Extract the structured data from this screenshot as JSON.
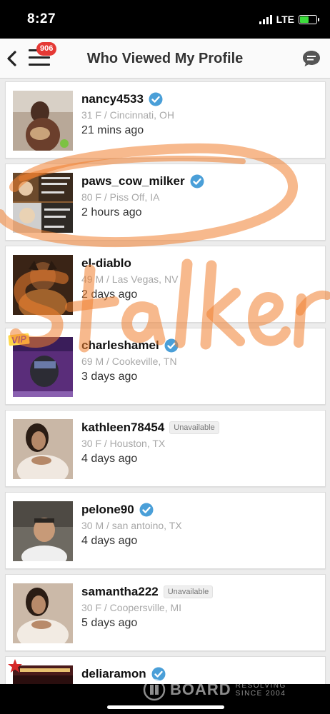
{
  "status": {
    "time": "8:27",
    "network": "LTE"
  },
  "nav": {
    "title": "Who Viewed My Profile",
    "badge": "906"
  },
  "viewers": [
    {
      "username": "nancy4533",
      "verified": true,
      "meta": "31 F / Cincinnati, OH",
      "time": "21 mins ago"
    },
    {
      "username": "paws_cow_milker",
      "verified": true,
      "meta": "80 F / Piss Off, IA",
      "time": "2 hours ago"
    },
    {
      "username": "el-diablo",
      "verified": false,
      "meta": "49 M / Las Vegas, NV",
      "time": "2 days ago"
    },
    {
      "username": "charleshamel",
      "verified": true,
      "vip": "VIP",
      "meta": "69 M / Cookeville, TN",
      "time": "3 days ago"
    },
    {
      "username": "kathleen78454",
      "verified": false,
      "unavailable": "Unavailable",
      "meta": "30 F / Houston, TX",
      "time": "4 days ago"
    },
    {
      "username": "pelone90",
      "verified": true,
      "meta": "30 M / san antoino, TX",
      "time": "4 days ago"
    },
    {
      "username": "samantha222",
      "verified": false,
      "unavailable": "Unavailable",
      "meta": "30 F / Coopersville, MI",
      "time": "5 days ago"
    },
    {
      "username": "deliaramon",
      "verified": true,
      "meta": "",
      "time": ""
    }
  ],
  "watermark": {
    "brand": "BOARD",
    "line1": "RESOLVING",
    "line2": "SINCE 2004"
  },
  "annotation": {
    "color": "#f08030",
    "text": "Stalker"
  },
  "colors": {
    "badge": "#e53935",
    "verified": "#4a9fd8",
    "vip_bg": "#ffd84a"
  }
}
